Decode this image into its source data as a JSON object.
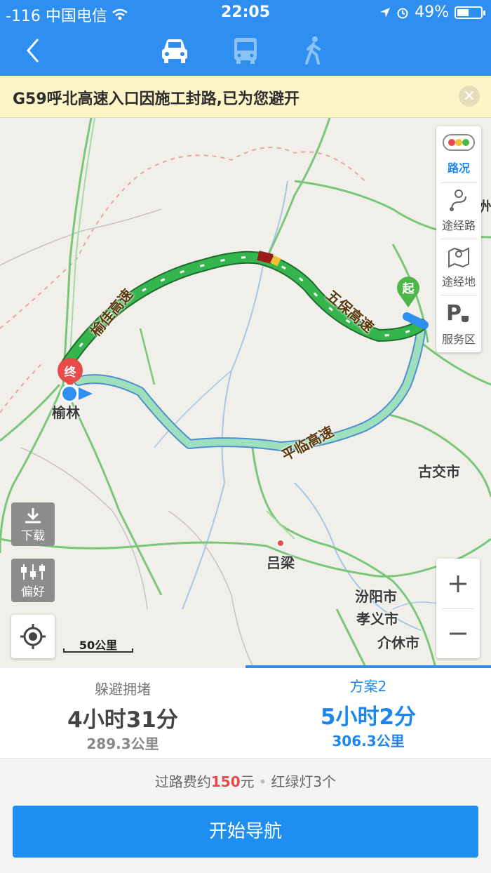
{
  "status_bar": {
    "carrier": "-116 中国电信",
    "time": "22:05",
    "battery": "49%",
    "battery_level": 0.49
  },
  "nav": {
    "modes": [
      "car-icon",
      "bus-icon",
      "walk-icon"
    ],
    "selected_mode": "car"
  },
  "alert": {
    "text": "G59呼北高速入口因施工封路,已为您避开"
  },
  "map": {
    "places": {
      "yulin": "榆林",
      "lvliang": "吕梁",
      "gujiao": "古交市",
      "fenyang": "汾阳市",
      "xiaoyi": "孝义市",
      "jiexiu": "介休市",
      "zhou": "州"
    },
    "roads": {
      "yubei": "榆佳高速",
      "wubao": "五保高速",
      "pinglin": "平临高速"
    },
    "markers": {
      "start": "起",
      "end": "终"
    },
    "side_panel": {
      "traffic": "路况",
      "via_road": "途经路",
      "via_place": "途经地",
      "service": "服务区"
    },
    "tools": {
      "download": "下载",
      "preference": "偏好"
    },
    "scale": "50公里"
  },
  "routes": [
    {
      "name": "躲避拥堵",
      "time": "4小时31分",
      "distance": "289.3公里"
    },
    {
      "name": "方案2",
      "time": "5小时2分",
      "distance": "306.3公里"
    }
  ],
  "summary": {
    "toll_prefix": "过路费约",
    "toll_amount": "150",
    "toll_suffix": "元",
    "lights": "红绿灯3个"
  },
  "start_button": "开始导航",
  "colors": {
    "primary": "#2f8ff0",
    "route_green": "#2fb34b",
    "route_alt": "#8fdcb5",
    "alert_bg": "#fdf5c8",
    "toll_red": "#e94b4b"
  }
}
